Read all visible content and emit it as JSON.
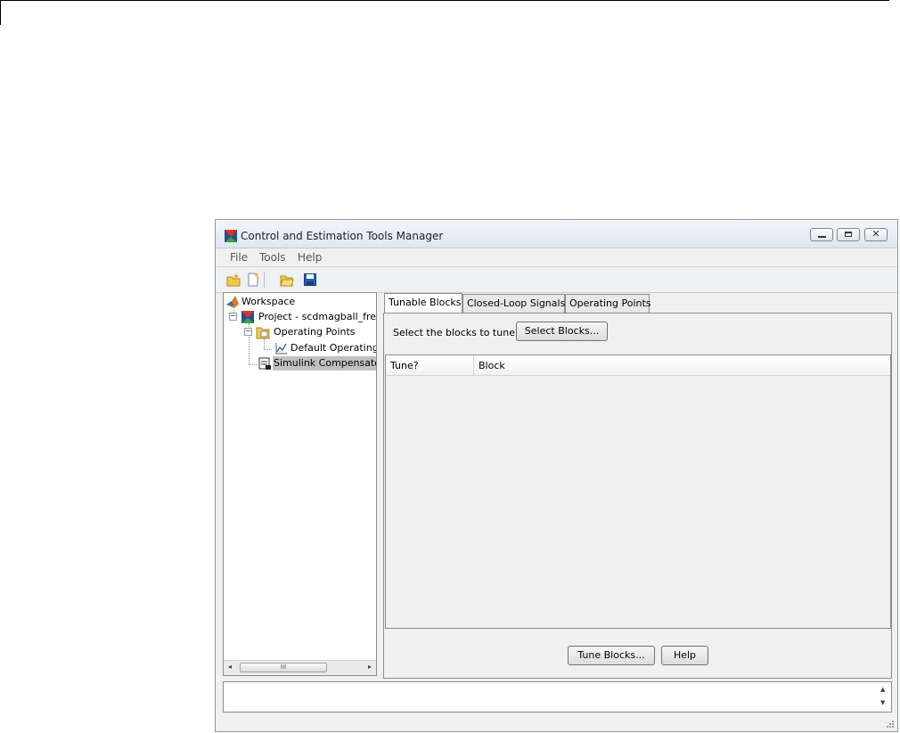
{
  "window": {
    "title": "Control and Estimation Tools Manager",
    "close_glyph": "✕"
  },
  "menu": {
    "items": [
      "File",
      "Tools",
      "Help"
    ]
  },
  "toolbar": {
    "icons": [
      "new-project-icon",
      "new-task-icon",
      "open-icon",
      "save-icon"
    ]
  },
  "tree": {
    "nodes": [
      {
        "label": "Workspace",
        "icon": "matlab-workspace-icon"
      },
      {
        "label": "Project - scdmagball_freef",
        "icon": "project-icon",
        "expander": "−"
      },
      {
        "label": "Operating Points",
        "icon": "folder-icon",
        "expander": "−"
      },
      {
        "label": "Default Operating P",
        "icon": "operating-point-icon"
      },
      {
        "label": "Simulink Compensator",
        "icon": "compensator-icon"
      }
    ],
    "scroll": {
      "left_glyph": "◂",
      "right_glyph": "▸",
      "thumb_glyph": "III"
    }
  },
  "tabs": [
    {
      "label": "Tunable Blocks",
      "active": true
    },
    {
      "label": "Closed-Loop Signals",
      "active": false
    },
    {
      "label": "Operating Points",
      "active": false
    }
  ],
  "tunable": {
    "select_label": "Select the blocks to tune:",
    "select_button": "Select Blocks...",
    "columns": [
      "Tune?",
      "Block"
    ]
  },
  "buttons": {
    "tune": "Tune Blocks...",
    "help": "Help"
  },
  "status": {
    "up_glyph": "▲",
    "down_glyph": "▼"
  },
  "colors": {
    "selection": "#c0c0c0",
    "window_bg": "#f0f0f0"
  }
}
